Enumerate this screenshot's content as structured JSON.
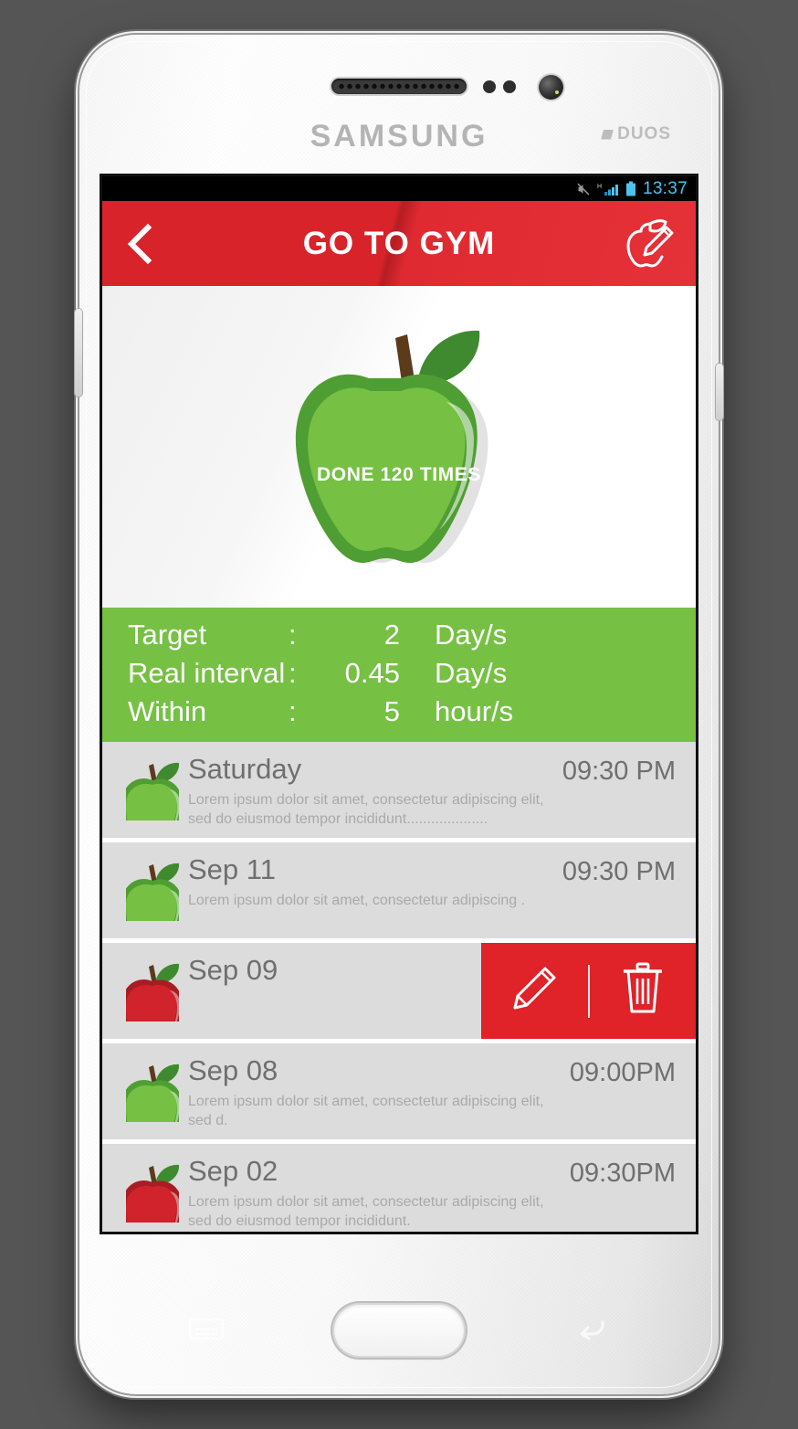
{
  "device": {
    "brand": "SAMSUNG",
    "variant": "DUOS",
    "earpiece_icon": "speaker-grill-icon",
    "camera_icon": "front-camera-icon",
    "home_button": "home-button",
    "menu_key": "menu-key-icon",
    "back_key": "back-key-icon"
  },
  "status_bar": {
    "time": "13:37",
    "mute_icon": "mute-icon",
    "signal_icon": "signal-h-icon",
    "network_type": "H",
    "battery_icon": "battery-icon"
  },
  "app_bar": {
    "back_icon": "back-chevron-icon",
    "title": "GO TO GYM",
    "action_icon": "apple-pencil-edit-icon"
  },
  "hero": {
    "apple_icon": "green-apple-icon",
    "done_label": "DONE 120 TIMES"
  },
  "stats": [
    {
      "label": "Target",
      "colon": ":",
      "value": "2",
      "unit": "Day/s"
    },
    {
      "label": "Real interval",
      "colon": ":",
      "value": "0.45",
      "unit": "Day/s"
    },
    {
      "label": "Within",
      "colon": ":",
      "value": "5",
      "unit": "hour/s"
    }
  ],
  "history": {
    "rows": [
      {
        "icon": "green-apple-icon",
        "apple_color": "green",
        "title": "Saturday",
        "desc": "Lorem ipsum dolor sit amet, consectetur adipiscing elit, sed do eiusmod tempor incididunt....................",
        "time": "09:30 PM",
        "swiped": false
      },
      {
        "icon": "green-apple-icon",
        "apple_color": "green",
        "title": "Sep 11",
        "desc": "Lorem ipsum dolor sit amet, consectetur adipiscing .",
        "time": "09:30 PM",
        "swiped": false
      },
      {
        "icon": "red-apple-icon",
        "apple_color": "red",
        "title": "Sep 09",
        "desc": "",
        "time": "",
        "swiped": true
      },
      {
        "icon": "green-apple-icon",
        "apple_color": "green",
        "title": "Sep 08",
        "desc": "Lorem ipsum dolor sit amet, consectetur adipiscing elit, sed d.",
        "time": "09:00PM",
        "swiped": false
      },
      {
        "icon": "red-apple-icon",
        "apple_color": "red",
        "title": "Sep 02",
        "desc": "Lorem ipsum dolor sit amet, consectetur adipiscing elit, sed do eiusmod tempor incididunt.",
        "time": "09:30PM",
        "swiped": false
      }
    ],
    "swipe_actions": {
      "edit_icon": "pencil-edit-icon",
      "delete_icon": "trash-delete-icon"
    }
  },
  "colors": {
    "accent_red": "#d8232a",
    "action_red": "#e02229",
    "accent_green": "#76c043",
    "apple_red": "#d0232b",
    "row_bg": "#dcdcdc",
    "page_bg": "#555555"
  }
}
